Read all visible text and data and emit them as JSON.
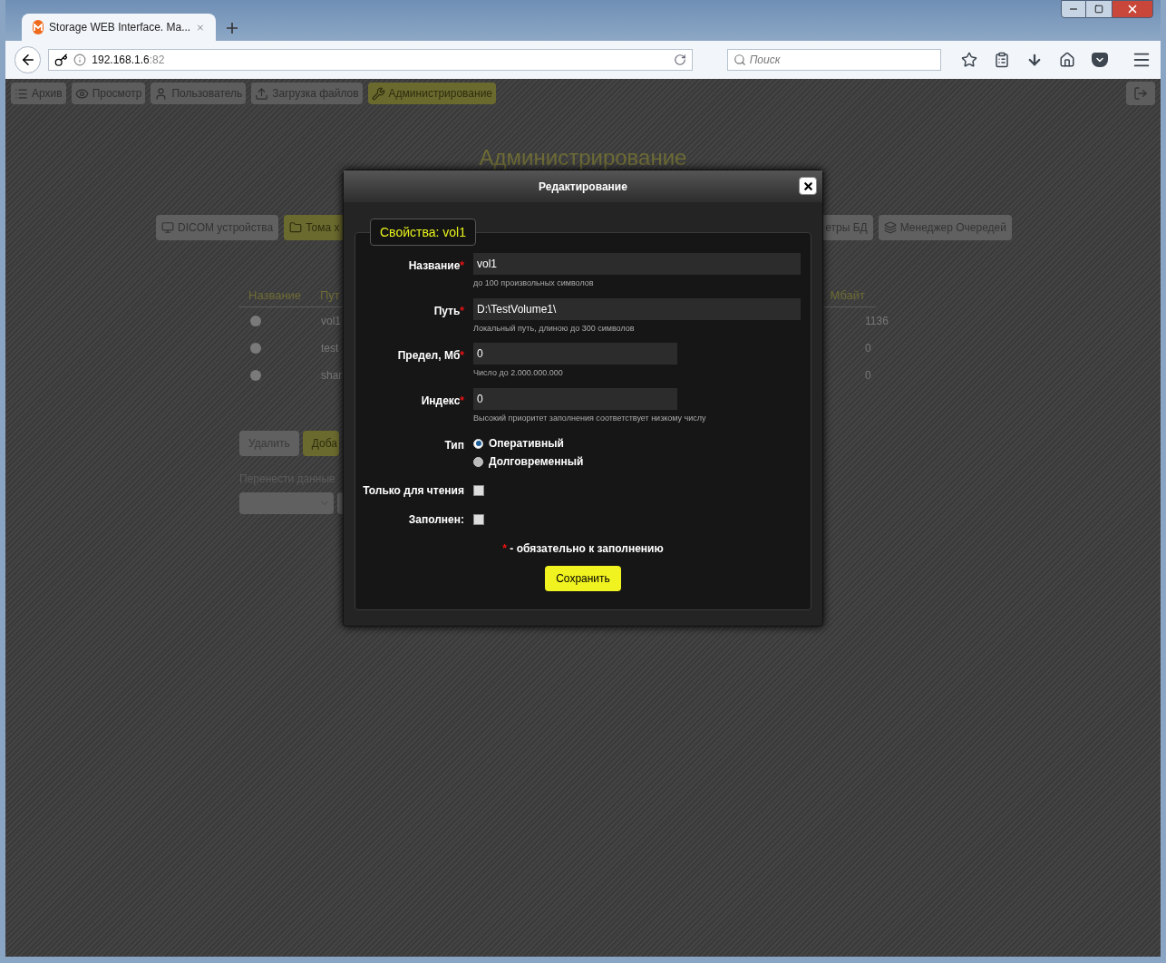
{
  "browser": {
    "tab_title": "Storage WEB Interface. Ma...",
    "url_host": "192.168.1.6",
    "url_port": ":82",
    "search_placeholder": "Поиск"
  },
  "nav": [
    {
      "label": "Архив",
      "selected": false
    },
    {
      "label": "Просмотр",
      "selected": false
    },
    {
      "label": "Пользователь",
      "selected": false
    },
    {
      "label": "Загрузка файлов",
      "selected": false
    },
    {
      "label": "Администрирование",
      "selected": true
    }
  ],
  "page_title": "Администрирование",
  "subtabs_left": [
    {
      "label": "DICOM устройства",
      "selected": false
    },
    {
      "label": "Тома х",
      "selected": true
    }
  ],
  "subtabs_right": [
    {
      "label": "етры БД",
      "selected": false
    },
    {
      "label": "Менеджер Очередей",
      "selected": false
    }
  ],
  "table": {
    "columns": [
      "Название",
      "Пут",
      "Мбайт"
    ],
    "rows": [
      {
        "name": "vol1",
        "size": "1136",
        "selected": false
      },
      {
        "name": "test",
        "size": "0",
        "selected": false
      },
      {
        "name": "shar",
        "size": "0",
        "selected": false
      }
    ]
  },
  "actions": [
    {
      "label": "Удалить",
      "kind": "plain"
    },
    {
      "label": "Доба",
      "kind": "accent"
    }
  ],
  "transfer_label": "Перенести данные",
  "dialog": {
    "title": "Редактирование",
    "legend": "Свойства: vol1",
    "required_mark": "*",
    "fields": [
      {
        "label": "Название",
        "required": true,
        "value": "vol1",
        "hint": "до 100 произвольных символов"
      },
      {
        "label": "Путь",
        "required": true,
        "value": "D:\\TestVolume1\\",
        "hint": "Локальный путь, длиною до 300 символов"
      },
      {
        "label": "Предел, Мб",
        "required": true,
        "value": "0",
        "hint": "Число до 2.000.000.000"
      },
      {
        "label": "Индекс",
        "required": true,
        "value": "0",
        "hint": "Высокий приоритет заполнения соответствует низкому числу"
      }
    ],
    "type": {
      "label": "Тип",
      "options": [
        {
          "label": "Оперативный",
          "selected": true
        },
        {
          "label": "Долговременный",
          "selected": false
        }
      ]
    },
    "checkboxes": [
      {
        "label": "Только для чтения",
        "checked": false
      },
      {
        "label": "Заполнен:",
        "checked": false
      }
    ],
    "required_note": "- обязательно к заполнению",
    "save": "Сохранить"
  }
}
